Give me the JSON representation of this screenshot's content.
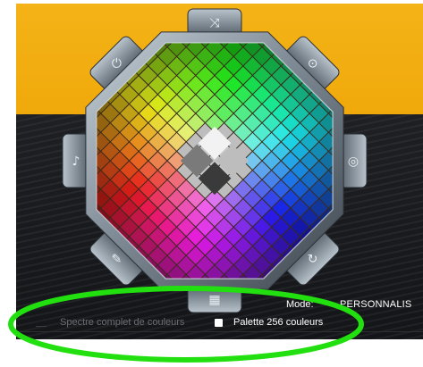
{
  "mode": {
    "label": "Mode:",
    "value": "PERSONNALIS"
  },
  "options": {
    "spectre": {
      "label": "Spectre complet de couleurs",
      "checked": false
    },
    "palette": {
      "label": "Palette 256 couleurs",
      "checked": true
    }
  },
  "wheel": {
    "edge_icons": [
      "shuffle-icon",
      "refresh-icon",
      "target-icon",
      "cycle-icon",
      "grid-icon",
      "palette-icon",
      "music-icon",
      "power-icon"
    ],
    "center_swatches": [
      "#f2f2f2",
      "#bdbdbd",
      "#7a7a7a",
      "#3a3a3a"
    ]
  },
  "annotation": {
    "highlight_color": "#22e00f"
  },
  "colors": {
    "background_band": "#f2ad10",
    "panel_dark": "#1a1c1f",
    "bezel": "#8c98a3"
  }
}
